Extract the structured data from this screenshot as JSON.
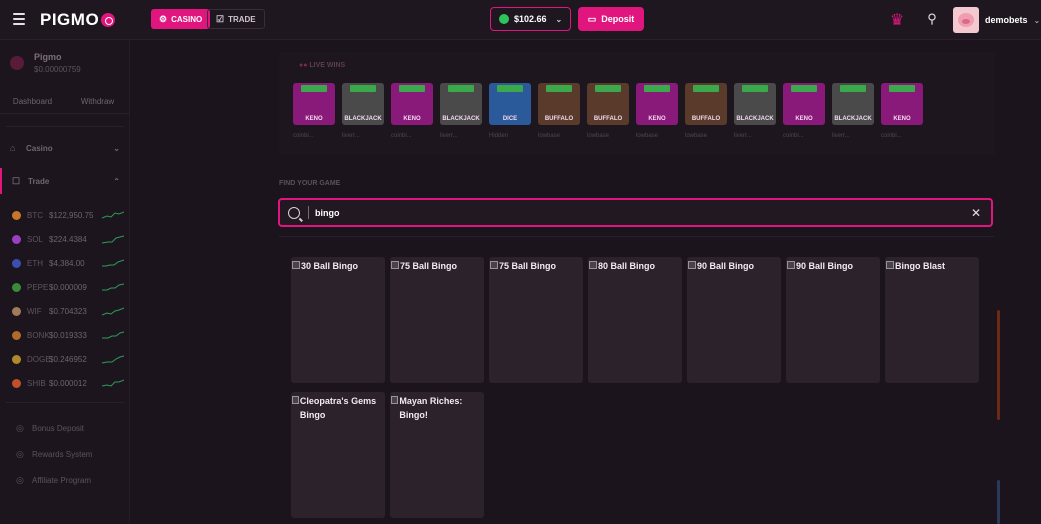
{
  "header": {
    "logo": "PIGMO",
    "tabs": [
      {
        "label": "CASINO",
        "active": true
      },
      {
        "label": "TRADE",
        "active": false
      }
    ],
    "balance": "$102.66",
    "deposit_label": "Deposit",
    "username": "demobets"
  },
  "sidebar": {
    "brand_name": "Pigmo",
    "brand_balance": "$0.00000759",
    "tabs": [
      "Dashboard",
      "Withdraw"
    ],
    "casino_label": "Casino",
    "trade_label": "Trade",
    "coins": [
      {
        "symbol": "BTC",
        "price": "$122,950.75",
        "color": "#c9762a"
      },
      {
        "symbol": "SOL",
        "price": "$224.4384",
        "color": "#9a3fc0"
      },
      {
        "symbol": "ETH",
        "price": "$4,384.00",
        "color": "#3a4fb0"
      },
      {
        "symbol": "PEPE",
        "price": "$0.000009",
        "color": "#3a8a3a"
      },
      {
        "symbol": "WIF",
        "price": "$0.704323",
        "color": "#a07a5a"
      },
      {
        "symbol": "BONK",
        "price": "$0.019333",
        "color": "#b06a2a"
      },
      {
        "symbol": "DOGE",
        "price": "$0.246952",
        "color": "#b08a2a"
      },
      {
        "symbol": "SHIB",
        "price": "$0.000012",
        "color": "#c0502a"
      }
    ],
    "links": [
      "Bonus Deposit",
      "Rewards System",
      "Affiliate Program"
    ]
  },
  "live_wins": {
    "title": "LIVE WINS",
    "tiles": [
      {
        "label": "KENO",
        "color": "#8a1a7a",
        "user": "coinbi..."
      },
      {
        "label": "BLACKJACK",
        "color": "#4a4a4a",
        "user": "liverr..."
      },
      {
        "label": "KENO",
        "color": "#8a1a7a",
        "user": "coinbi..."
      },
      {
        "label": "BLACKJACK",
        "color": "#4a4a4a",
        "user": "liverr..."
      },
      {
        "label": "DICE",
        "color": "#2a5a9a",
        "user": "Hidden"
      },
      {
        "label": "BUFFALO",
        "color": "#5a3a2a",
        "user": "lowbase"
      },
      {
        "label": "BUFFALO",
        "color": "#5a3a2a",
        "user": "lowbase"
      },
      {
        "label": "KENO",
        "color": "#8a1a7a",
        "user": "lowbase"
      },
      {
        "label": "BUFFALO",
        "color": "#5a3a2a",
        "user": "lowbase"
      },
      {
        "label": "BLACKJACK",
        "color": "#4a4a4a",
        "user": "liverr..."
      },
      {
        "label": "KENO",
        "color": "#8a1a7a",
        "user": "coinbi..."
      },
      {
        "label": "BLACKJACK",
        "color": "#4a4a4a",
        "user": "liverr..."
      },
      {
        "label": "KENO",
        "color": "#8a1a7a",
        "user": "coinbi..."
      }
    ]
  },
  "find": {
    "label": "FIND YOUR GAME",
    "query": "bingo"
  },
  "results": [
    "30 Ball Bingo",
    "75 Ball Bingo",
    "75 Ball Bingo",
    "80 Ball Bingo",
    "90 Ball Bingo",
    "90 Ball Bingo",
    "Bingo Blast",
    "Cleopatra's Gems Bingo",
    "Mayan Riches: Bingo!"
  ]
}
